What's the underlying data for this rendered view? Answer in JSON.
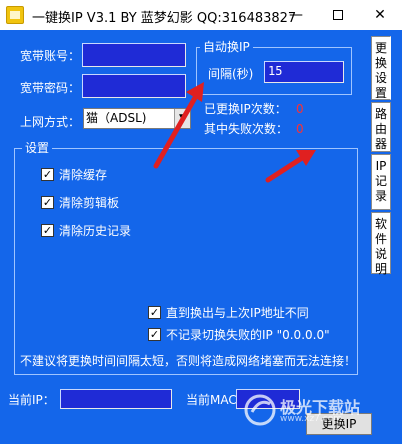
{
  "window": {
    "title": "一键换IP V3.1 BY 蓝梦幻影 QQ:316483827",
    "minimize": "—",
    "close": "✕"
  },
  "account": {
    "username_label": "宽带账号：",
    "username_value": "",
    "password_label": "宽带密码：",
    "password_value": "",
    "connection_label": "上网方式：",
    "connection_value": "猫（ADSL)"
  },
  "auto_switch": {
    "group_title": "自动换IP",
    "interval_label": "间隔(秒)",
    "interval_value": "15"
  },
  "stats": {
    "switched_label": "已更换IP次数：",
    "switched_value": "0",
    "failed_label": "其中失败次数：",
    "failed_value": "0"
  },
  "settings": {
    "group_title": "设置",
    "options": [
      {
        "label": "清除缓存",
        "checked": true
      },
      {
        "label": "清除剪辑板",
        "checked": true
      },
      {
        "label": "清除历史记录",
        "checked": true
      },
      {
        "label": "直到换出与上次IP地址不同",
        "checked": true
      },
      {
        "label": "不记录切换失败的IP \"0.0.0.0\"",
        "checked": true
      }
    ],
    "warning": "不建议将更换时间间隔太短，否则将造成网络堵塞而无法连接！"
  },
  "footer": {
    "current_ip_label": "当前IP：",
    "current_ip_value": "",
    "current_mac_label": "当前MAC：",
    "current_mac_value": "",
    "action_button": "更换IP"
  },
  "tabs": [
    {
      "label": "更换设置",
      "active": true
    },
    {
      "label": "路由器",
      "active": false
    },
    {
      "label": "IP记录",
      "active": false
    },
    {
      "label": "软件说明",
      "active": false
    }
  ],
  "watermark": {
    "text": "极光下载站",
    "sub": "www.xz7.com"
  },
  "colors": {
    "background": "#1466ea",
    "field": "#1f2bd6",
    "count": "#ff3030",
    "arrow": "#e02020"
  }
}
